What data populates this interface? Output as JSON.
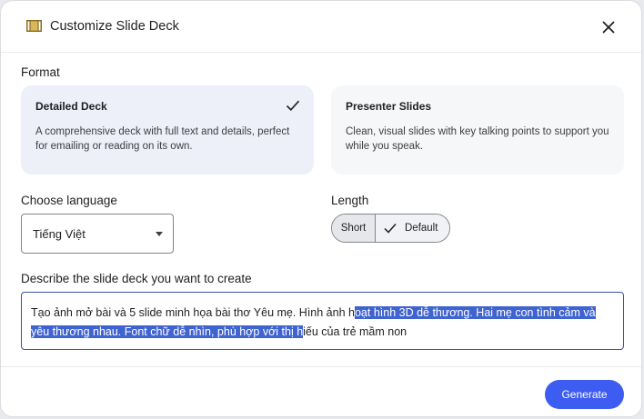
{
  "dialog": {
    "title": "Customize Slide Deck",
    "icon": "slide-deck-icon",
    "close_icon": "close-icon"
  },
  "format": {
    "label": "Format",
    "options": [
      {
        "title": "Detailed Deck",
        "description": "A comprehensive deck with full text and details, perfect for emailing or reading on its own.",
        "selected": true
      },
      {
        "title": "Presenter Slides",
        "description": "Clean, visual slides with key talking points to support you while you speak.",
        "selected": false
      }
    ]
  },
  "language": {
    "label": "Choose language",
    "selected": "Tiếng Việt"
  },
  "length": {
    "label": "Length",
    "options": [
      {
        "label": "Short",
        "selected": false
      },
      {
        "label": "Default",
        "selected": true
      }
    ]
  },
  "description": {
    "label": "Describe the slide deck you want to create",
    "value_before_selection": "Tạo ảnh mở bài và 5 slide minh họa bài thơ Yêu mẹ. Hình ảnh h",
    "value_selected": "oạt hình 3D dễ thương. Hai mẹ con tình cảm và yêu thương nhau. Font chữ dễ nhìn, phù hợp với thị h",
    "value_after_selection": "iếu của trẻ mầm non"
  },
  "actions": {
    "generate_label": "Generate"
  },
  "colors": {
    "accent": "#3d5cf2",
    "selected_card": "#edeff9",
    "selection_highlight": "#3f63d0",
    "input_border": "#3850a8"
  }
}
